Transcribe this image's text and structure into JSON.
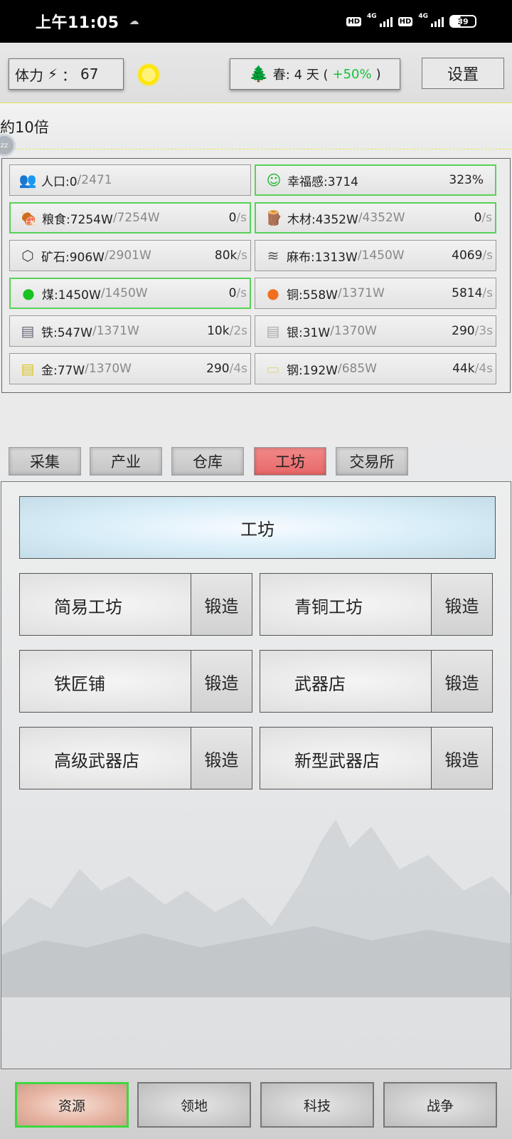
{
  "status_bar": {
    "time": "上午11:05",
    "hd1": "HD",
    "net1": "4G",
    "hd2": "HD",
    "net2": "4G",
    "battery": "39"
  },
  "top": {
    "stamina_label": "体力",
    "stamina_sep": "：",
    "stamina_value": "67",
    "season_label": "春: 4 天 (",
    "season_bonus": "+50%",
    "season_close": ")",
    "settings": "设置"
  },
  "ticker": {
    "text": "約10倍",
    "bubble": "zz"
  },
  "resources": [
    {
      "name": "人口:0",
      "cap": "/2471",
      "rate": "",
      "unit": "",
      "ok": false,
      "icon": "people-icon"
    },
    {
      "name": "幸福感:3714",
      "cap": "",
      "rate": "323%",
      "unit": "",
      "ok": true,
      "icon": "smile-icon"
    },
    {
      "name": "粮食:7254W",
      "cap": "/7254W",
      "rate": "0",
      "unit": "/s",
      "ok": true,
      "icon": "food-icon"
    },
    {
      "name": "木材:4352W",
      "cap": "/4352W",
      "rate": "0",
      "unit": "/s",
      "ok": true,
      "icon": "wood-icon"
    },
    {
      "name": "矿石:906W",
      "cap": "/2901W",
      "rate": "80k",
      "unit": "/s",
      "ok": false,
      "icon": "ore-icon"
    },
    {
      "name": "麻布:1313W",
      "cap": "/1450W",
      "rate": "4069",
      "unit": "/s",
      "ok": false,
      "icon": "linen-icon"
    },
    {
      "name": "煤:1450W",
      "cap": "/1450W",
      "rate": "0",
      "unit": "/s",
      "ok": true,
      "icon": "coal-icon"
    },
    {
      "name": "铜:558W",
      "cap": "/1371W",
      "rate": "5814",
      "unit": "/s",
      "ok": false,
      "icon": "copper-icon"
    },
    {
      "name": "铁:547W",
      "cap": "/1371W",
      "rate": "10k",
      "unit": "/2s",
      "ok": false,
      "icon": "iron-icon"
    },
    {
      "name": "银:31W",
      "cap": "/1370W",
      "rate": "290",
      "unit": "/3s",
      "ok": false,
      "icon": "silver-icon"
    },
    {
      "name": "金:77W",
      "cap": "/1370W",
      "rate": "290",
      "unit": "/4s",
      "ok": false,
      "icon": "gold-icon"
    },
    {
      "name": "钢:192W",
      "cap": "/685W",
      "rate": "44k",
      "unit": "/4s",
      "ok": false,
      "icon": "steel-icon"
    }
  ],
  "tabs": [
    "采集",
    "产业",
    "仓库",
    "工坊",
    "交易所"
  ],
  "active_tab": "工坊",
  "workshop": {
    "title": "工坊",
    "items": [
      {
        "name": "简易工坊",
        "action": "锻造"
      },
      {
        "name": "青铜工坊",
        "action": "锻造"
      },
      {
        "name": "铁匠铺",
        "action": "锻造"
      },
      {
        "name": "武器店",
        "action": "锻造"
      },
      {
        "name": "高级武器店",
        "action": "锻造"
      },
      {
        "name": "新型武器店",
        "action": "锻造"
      }
    ]
  },
  "bottom_nav": [
    "资源",
    "领地",
    "科技",
    "战争"
  ],
  "colors": {
    "accent_green": "#12c23a",
    "active_tab": "#e76767",
    "ok_border": "#58d158"
  }
}
